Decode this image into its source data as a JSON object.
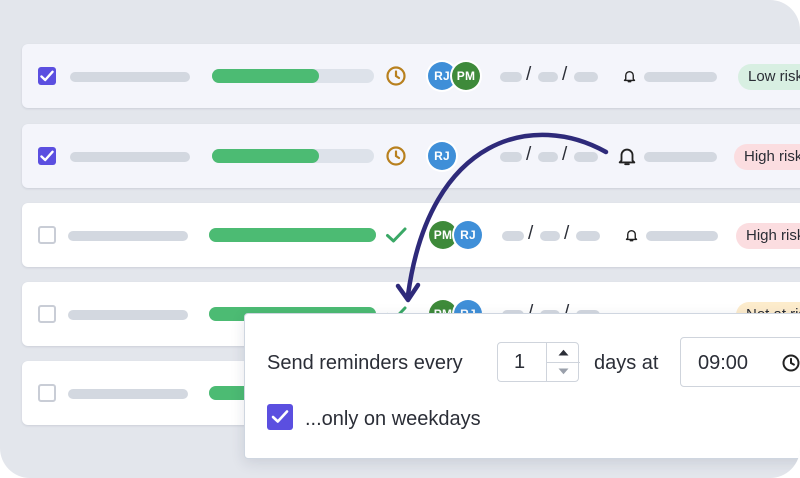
{
  "rows": [
    {
      "selected": true,
      "progress": 0.66,
      "status_icon": "clock-icon",
      "avatars": [
        "RJ",
        "PM"
      ],
      "risk_label": "Low risk",
      "risk_color": "#d8efe2"
    },
    {
      "selected": true,
      "progress": 0.66,
      "status_icon": "clock-icon",
      "avatars": [
        "RJ"
      ],
      "risk_label": "High risk",
      "risk_color": "#fbdde0"
    },
    {
      "selected": false,
      "progress": 1.0,
      "status_icon": "check-icon",
      "avatars": [
        "PM",
        "RJ"
      ],
      "risk_label": "High risk",
      "risk_color": "#fbdde0"
    },
    {
      "selected": false,
      "progress": 1.0,
      "status_icon": "check-icon",
      "avatars": [
        "PM",
        "RJ"
      ],
      "risk_label": "Not at risk",
      "risk_color": "#fdeccc"
    },
    {
      "selected": false,
      "progress": 1.0,
      "status_icon": "check-icon",
      "avatars": [],
      "risk_label": "",
      "risk_color": "#ffffff"
    }
  ],
  "date_separator": "/",
  "reminder": {
    "label_prefix": "Send reminders every",
    "interval_value": "1",
    "label_suffix": "days at",
    "time_value": "09:00",
    "weekdays_label": "...only on weekdays",
    "weekdays_checked": true
  },
  "colors": {
    "accent": "#5b4fe0",
    "progress": "#4cbb73",
    "clock": "#b8801e",
    "check": "#3aa866",
    "arrow": "#2e2a7a"
  },
  "icons": {
    "bell": "bell-icon",
    "arrow": "curved-arrow-icon",
    "time": "clock-icon"
  }
}
